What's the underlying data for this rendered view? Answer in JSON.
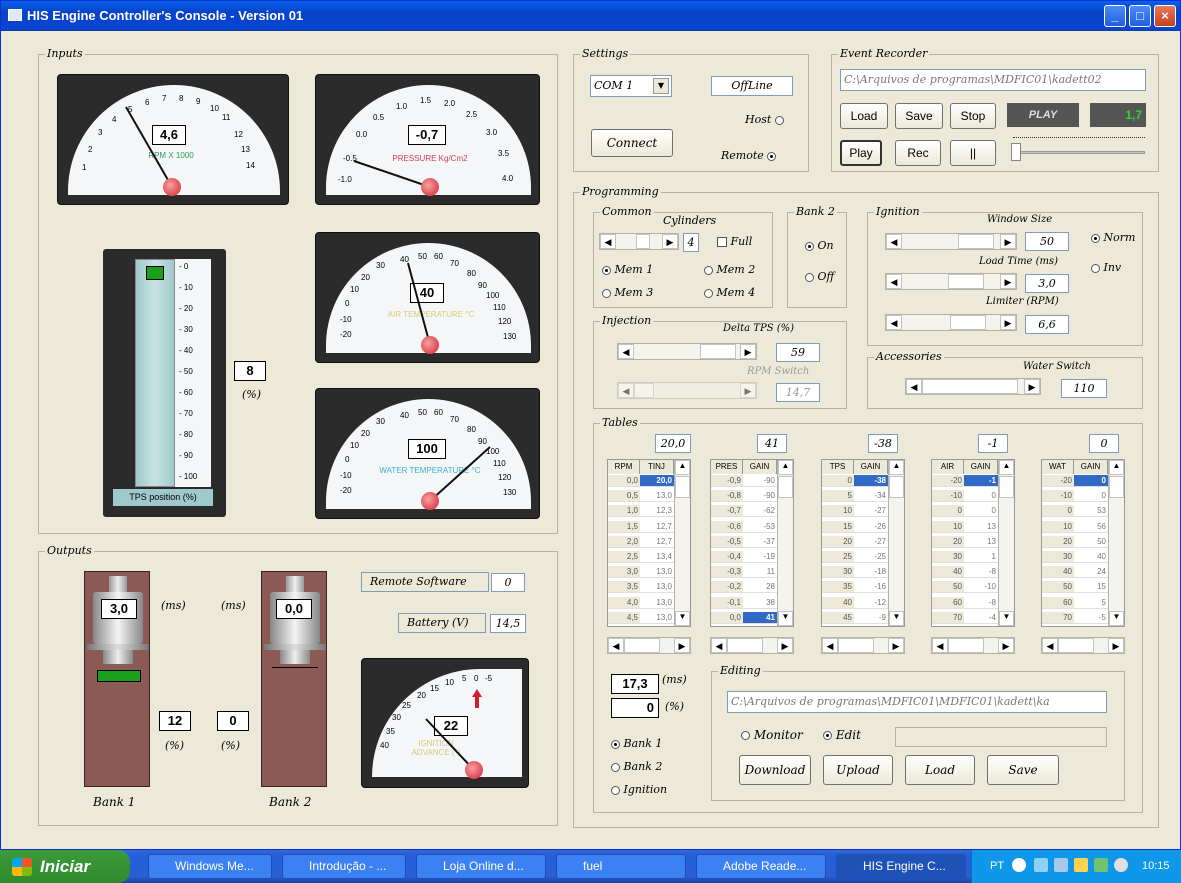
{
  "window": {
    "title": "HIS Engine Controller's Console - Version 01"
  },
  "inputs": {
    "legend": "Inputs",
    "rpm": {
      "value": "4,6",
      "label": "RPM X 1000",
      "ticks": [
        "1",
        "2",
        "3",
        "4",
        "5",
        "6",
        "7",
        "8",
        "9",
        "10",
        "11",
        "12",
        "13",
        "14"
      ]
    },
    "pressure": {
      "value": "-0,7",
      "label": "PRESSURE Kg/Cm2",
      "ticks": [
        "-1.0",
        "-0.5",
        "0.0",
        "0.5",
        "1.0",
        "1.5",
        "2.0",
        "2.5",
        "3.0",
        "3.5",
        "4.0"
      ]
    },
    "air_temp": {
      "value": "40",
      "label": "AIR TEMPERATURE °C",
      "ticks": [
        "-20",
        "-10",
        "0",
        "10",
        "20",
        "30",
        "40",
        "50",
        "60",
        "70",
        "80",
        "90",
        "100",
        "110",
        "120",
        "130"
      ]
    },
    "water_temp": {
      "value": "100",
      "label": "WATER TEMPERATURE °C",
      "ticks": [
        "-20",
        "-10",
        "0",
        "10",
        "20",
        "30",
        "40",
        "50",
        "60",
        "70",
        "80",
        "90",
        "100",
        "110",
        "120",
        "130"
      ]
    },
    "tps": {
      "value": "8",
      "unit": "(%)",
      "label": "TPS position (%)",
      "level_percent": 8,
      "scale": [
        "0",
        "10",
        "20",
        "30",
        "40",
        "50",
        "60",
        "70",
        "80",
        "90",
        "100"
      ]
    }
  },
  "outputs": {
    "legend": "Outputs",
    "bank1": {
      "value": "3,0",
      "unit": "(ms)",
      "duty": "12",
      "duty_unit": "(%)",
      "label": "Bank 1"
    },
    "bank2": {
      "value": "0,0",
      "unit": "(ms)",
      "duty": "0",
      "duty_unit": "(%)",
      "label": "Bank 2"
    },
    "remote_software_label": "Remote Software",
    "remote_software_value": "0",
    "battery_label": "Battery (V)",
    "battery_value": "14,5",
    "ignition": {
      "value": "22",
      "label": "IGNITION ADVANCE (°)",
      "ticks": [
        "40",
        "35",
        "30",
        "25",
        "20",
        "15",
        "10",
        "5",
        "0",
        "-5"
      ]
    }
  },
  "settings": {
    "legend": "Settings",
    "port": "COM 1",
    "status": "OffLine",
    "connect_label": "Connect",
    "host_label": "Host",
    "remote_label": "Remote",
    "selected": "Remote"
  },
  "event_recorder": {
    "legend": "Event Recorder",
    "path": "C:\\Arquivos de programas\\MDFIC01\\kadett02",
    "load": "Load",
    "save": "Save",
    "stop": "Stop",
    "play": "Play",
    "rec": "Rec",
    "pause": "||",
    "display": "PLAY",
    "counter": "1,7"
  },
  "programming": {
    "legend": "Programming",
    "common": {
      "legend": "Common",
      "cylinders_label": "Cylinders",
      "cylinders": "4",
      "full_label": "Full",
      "mem": [
        "Mem 1",
        "Mem 2",
        "Mem 3",
        "Mem 4"
      ]
    },
    "bank2": {
      "legend": "Bank 2",
      "on": "On",
      "off": "Off"
    },
    "ignition": {
      "legend": "Ignition",
      "window_label": "Window Size",
      "window": "50",
      "load_time_label": "Load Time (ms)",
      "load_time": "3,0",
      "limiter_label": "Limiter (RPM)",
      "limiter": "6,6",
      "norm": "Norm",
      "inv": "Inv"
    },
    "injection": {
      "legend": "Injection",
      "delta_label": "Delta TPS (%)",
      "delta": "59",
      "rpm_switch_label": "RPM Switch",
      "rpm_switch": "14,7"
    },
    "accessories": {
      "legend": "Accessories",
      "water_switch_label": "Water Switch",
      "water_switch": "110"
    }
  },
  "tables": {
    "legend": "Tables",
    "grids": [
      {
        "top": "20,0",
        "k": "RPM",
        "v": "TINJ",
        "keys": [
          "0,0",
          "0,5",
          "1,0",
          "1,5",
          "2,0",
          "2,5",
          "3,0",
          "3,5",
          "4,0",
          "4,5"
        ],
        "vals": [
          "20,0",
          "13,0",
          "12,3",
          "12,7",
          "12,7",
          "13,4",
          "13,0",
          "13,0",
          "13,0",
          "13,0"
        ],
        "sel": 0
      },
      {
        "top": "41",
        "k": "PRES",
        "v": "GAIN",
        "keys": [
          "-0,9",
          "-0,8",
          "-0,7",
          "-0,6",
          "-0,5",
          "-0,4",
          "-0,3",
          "-0,2",
          "-0,1",
          "0,0"
        ],
        "vals": [
          "-90",
          "-90",
          "-62",
          "-53",
          "-37",
          "-19",
          "11",
          "28",
          "38",
          "41"
        ],
        "sel": 9
      },
      {
        "top": "-38",
        "k": "TPS",
        "v": "GAIN",
        "keys": [
          "0",
          "5",
          "10",
          "15",
          "20",
          "25",
          "30",
          "35",
          "40",
          "45"
        ],
        "vals": [
          "-38",
          "-34",
          "-27",
          "-26",
          "-27",
          "-25",
          "-18",
          "-16",
          "-12",
          "-9"
        ],
        "sel": 0
      },
      {
        "top": "-1",
        "k": "AIR",
        "v": "GAIN",
        "keys": [
          "-20",
          "-10",
          "0",
          "10",
          "20",
          "30",
          "40",
          "50",
          "60",
          "70"
        ],
        "vals": [
          "-1",
          "0",
          "0",
          "13",
          "13",
          "1",
          "-8",
          "-10",
          "-8",
          "-4"
        ],
        "sel": 0
      },
      {
        "top": "0",
        "k": "WAT",
        "v": "GAIN",
        "keys": [
          "-20",
          "-10",
          "0",
          "10",
          "20",
          "30",
          "40",
          "50",
          "60",
          "70"
        ],
        "vals": [
          "0",
          "0",
          "53",
          "56",
          "50",
          "40",
          "24",
          "15",
          "5",
          "-5"
        ],
        "sel": 0
      }
    ],
    "ms_value": "17,3",
    "ms_unit": "(ms)",
    "pct_value": "0",
    "pct_unit": "(%)",
    "bank_options": [
      "Bank 1",
      "Bank 2",
      "Ignition"
    ]
  },
  "editing": {
    "legend": "Editing",
    "path": "C:\\Arquivos de programas\\MDFIC01\\MDFIC01\\kadett\\ka",
    "monitor": "Monitor",
    "edit": "Edit",
    "download": "Download",
    "upload": "Upload",
    "load": "Load",
    "save": "Save"
  },
  "taskbar": {
    "start": "Iniciar",
    "tasks": [
      "Windows Me...",
      "Introdução - ...",
      "Loja Online d...",
      "fuel",
      "Adobe Reade...",
      "HIS Engine C..."
    ],
    "lang": "PT",
    "clock": "10:15"
  }
}
